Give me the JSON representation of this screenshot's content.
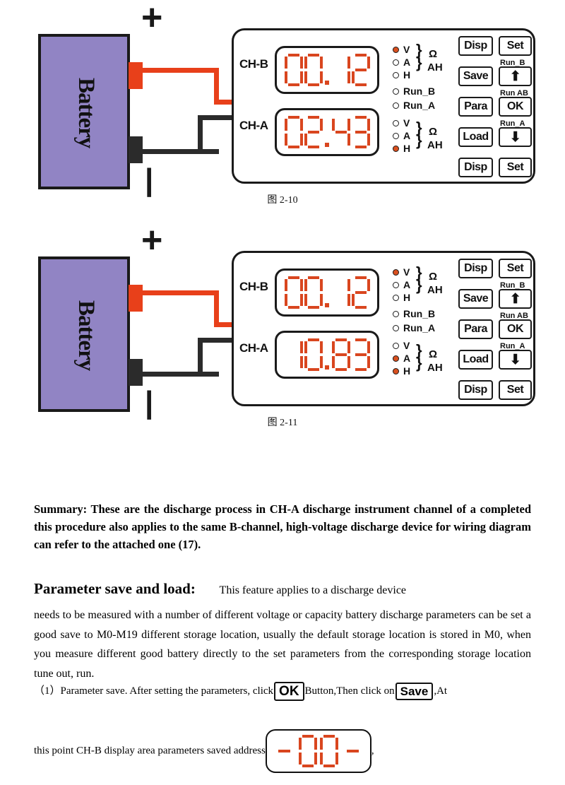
{
  "document": {
    "figures": [
      {
        "id": "fig-2-10",
        "caption": "图 2-10",
        "battery_label": "Battery",
        "plus_sign": "+",
        "minus_sign": "|",
        "panel": {
          "channels": [
            {
              "label": "CH-B",
              "display": "00.12",
              "leds": [
                {
                  "name": "V",
                  "on": true
                },
                {
                  "name": "A",
                  "on": false
                },
                {
                  "name": "H",
                  "on": false
                }
              ],
              "units": [
                "Ω",
                "AH"
              ]
            },
            {
              "label": "CH-A",
              "display": "02.43",
              "leds": [
                {
                  "name": "V",
                  "on": false
                },
                {
                  "name": "A",
                  "on": false
                },
                {
                  "name": "H",
                  "on": true
                }
              ],
              "units": [
                "Ω",
                "AH"
              ]
            }
          ],
          "run_leds": [
            {
              "name": "Run_B",
              "on": false
            },
            {
              "name": "Run_A",
              "on": false
            }
          ],
          "buttons_left": [
            "Disp",
            "Save",
            "Para",
            "Load",
            "Disp"
          ],
          "buttons_right": [
            "Set",
            "⬆",
            "OK",
            "⬇",
            "Set"
          ],
          "button_tags": [
            "Run_B",
            "Run AB",
            "Run_A"
          ]
        }
      },
      {
        "id": "fig-2-11",
        "caption": "图 2-11",
        "battery_label": "Battery",
        "plus_sign": "+",
        "minus_sign": "|",
        "panel": {
          "channels": [
            {
              "label": "CH-B",
              "display": "00.12",
              "leds": [
                {
                  "name": "V",
                  "on": true
                },
                {
                  "name": "A",
                  "on": false
                },
                {
                  "name": "H",
                  "on": false
                }
              ],
              "units": [
                "Ω",
                "AH"
              ]
            },
            {
              "label": "CH-A",
              "display": "10.83",
              "leds": [
                {
                  "name": "V",
                  "on": false
                },
                {
                  "name": "A",
                  "on": true
                },
                {
                  "name": "H",
                  "on": true
                }
              ],
              "units": [
                "Ω",
                "AH"
              ]
            }
          ],
          "run_leds": [
            {
              "name": "Run_B",
              "on": false
            },
            {
              "name": "Run_A",
              "on": false
            }
          ],
          "buttons_left": [
            "Disp",
            "Save",
            "Para",
            "Load",
            "Disp"
          ],
          "buttons_right": [
            "Set",
            "⬆",
            "OK",
            "⬇",
            "Set"
          ],
          "button_tags": [
            "Run_B",
            "Run AB",
            "Run_A"
          ]
        }
      }
    ],
    "summary_paragraph": "Summary: These are the discharge process in CH-A discharge instrument channel of a completed this procedure also applies to the same B-channel, high-voltage discharge device for wiring diagram can refer to the attached one (17).",
    "section_heading": "Parameter save and load:",
    "section_heading_tail": "This feature applies to a discharge device",
    "section_body": "needs to be measured with a number of different voltage or capacity battery discharge parameters can be set a good save to M0-M19 different storage location, usually the default storage location is stored in M0, when you measure different good battery directly to the set parameters from the corresponding storage location tune out, run.",
    "step_one": {
      "prefix": "（1）Parameter save. After setting the parameters, click",
      "button_ok": "OK",
      "middle": "Button,Then click on",
      "button_save": "Save",
      "suffix": ",At",
      "line2_prefix": "this point CH-B display area parameters saved address",
      "seg_display": "- 00 -",
      "line2_suffix": ","
    }
  },
  "colors": {
    "battery_fill": "#9184c4",
    "wire_positive": "#e8401a",
    "wire_negative": "#2b2b2b",
    "segment_on": "#d9461f",
    "led_on": "#d9501f",
    "outline": "#1a1a1a"
  }
}
